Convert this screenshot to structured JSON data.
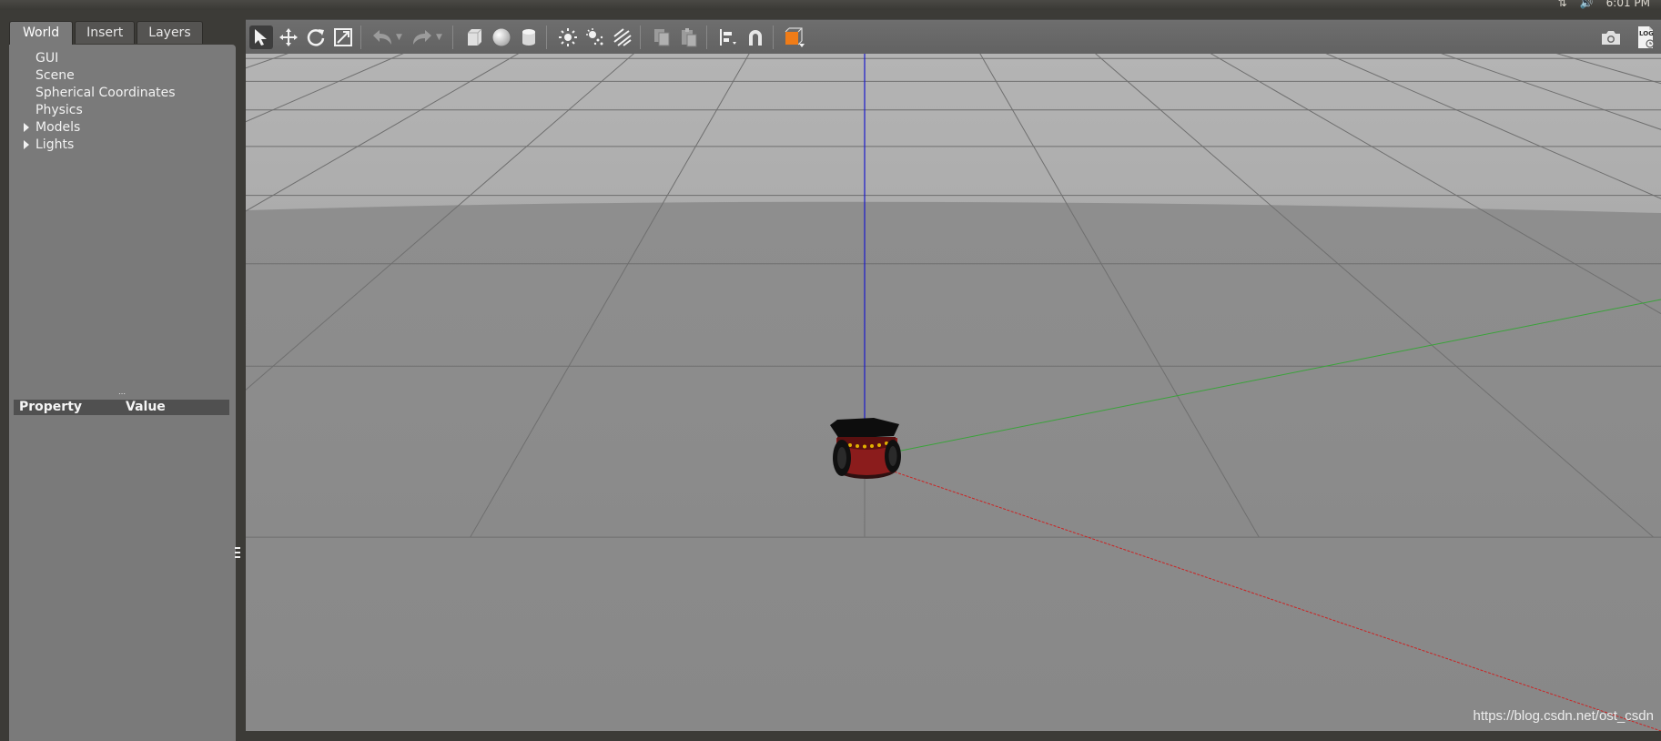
{
  "system_bar": {
    "time": "6:01 PM",
    "icons": [
      "network-icon",
      "volume-icon"
    ]
  },
  "left_panel": {
    "tabs": [
      {
        "label": "World",
        "active": true
      },
      {
        "label": "Insert",
        "active": false
      },
      {
        "label": "Layers",
        "active": false
      }
    ],
    "tree": [
      {
        "label": "GUI",
        "expandable": false
      },
      {
        "label": "Scene",
        "expandable": false
      },
      {
        "label": "Spherical Coordinates",
        "expandable": false
      },
      {
        "label": "Physics",
        "expandable": false
      },
      {
        "label": "Models",
        "expandable": true
      },
      {
        "label": "Lights",
        "expandable": true
      }
    ],
    "property_table": {
      "columns": [
        "Property",
        "Value"
      ]
    }
  },
  "toolbar": {
    "tools": [
      {
        "icon": "select-arrow-icon",
        "active": true
      },
      {
        "icon": "translate-icon"
      },
      {
        "icon": "rotate-icon"
      },
      {
        "icon": "scale-icon"
      },
      {
        "icon": "undo-icon",
        "disabled": true
      },
      {
        "icon": "redo-icon",
        "disabled": true
      },
      {
        "icon": "box-shape-icon"
      },
      {
        "icon": "sphere-shape-icon"
      },
      {
        "icon": "cylinder-shape-icon"
      },
      {
        "icon": "point-light-icon"
      },
      {
        "icon": "spot-light-icon"
      },
      {
        "icon": "directional-light-icon"
      },
      {
        "icon": "copy-icon"
      },
      {
        "icon": "paste-icon"
      },
      {
        "icon": "align-icon"
      },
      {
        "icon": "snap-magnet-icon"
      },
      {
        "icon": "view-angle-icon"
      }
    ],
    "right_tools": [
      {
        "icon": "screenshot-camera-icon"
      },
      {
        "icon": "log-icon",
        "label": "LOG"
      }
    ]
  },
  "viewport": {
    "sky_color": "#b1b1b1",
    "ground_color": "#8d8d8d",
    "axis_colors": {
      "x": "#cc2222",
      "y": "#3aa33a",
      "z": "#1a1acc"
    },
    "robot_body_color": "#8b1c1c"
  },
  "watermark": "https://blog.csdn.net/ost_csdn"
}
